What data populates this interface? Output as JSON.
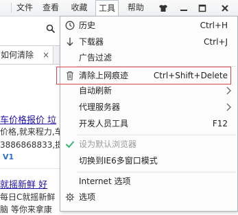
{
  "menubar": {
    "items": [
      {
        "label": "文件"
      },
      {
        "label": "查看"
      },
      {
        "label": "收藏"
      },
      {
        "label": "工具"
      },
      {
        "label": "帮助"
      }
    ]
  },
  "tab": {
    "label": "如何清除",
    "close": "×"
  },
  "page": {
    "line1": "车价格报价 垃",
    "line2": "价格,就来程力,车",
    "line3": "3886868833,提",
    "line4": "V1",
    "line5": "就摇新鲜 好",
    "line6": "每日C就摇新鲜",
    "line7": "脑 等你来拿康"
  },
  "dropdown": {
    "items": [
      {
        "label": "历史",
        "shortcut": "Ctrl+H",
        "icon": "clock-icon"
      },
      {
        "label": "下载器",
        "shortcut": "Ctrl+J",
        "icon": "download-arrow-icon"
      },
      {
        "label": "广告过滤",
        "shortcut": "",
        "icon": ""
      },
      {
        "label": "清除上网痕迹",
        "shortcut": "Ctrl+Shift+Delete",
        "icon": "trash-icon"
      },
      {
        "label": "自动刷新",
        "shortcut": "",
        "icon": "",
        "submenu": true
      },
      {
        "label": "代理服务器",
        "shortcut": "",
        "icon": "",
        "submenu": true
      },
      {
        "label": "开发人员工具",
        "shortcut": "F12",
        "icon": ""
      },
      {
        "label": "设为默认浏览器",
        "shortcut": "",
        "icon": "checkmark-icon",
        "disabled": true
      },
      {
        "label": "切换到IE6多窗口模式",
        "shortcut": "",
        "icon": ""
      },
      {
        "label": "Internet 选项",
        "shortcut": "",
        "icon": ""
      },
      {
        "label": "选项",
        "shortcut": "",
        "icon": "gear-icon"
      }
    ]
  },
  "colors": {
    "highlight_border": "#d9474b",
    "check_green": "#3cb371",
    "link_blue": "#1a0dab"
  }
}
